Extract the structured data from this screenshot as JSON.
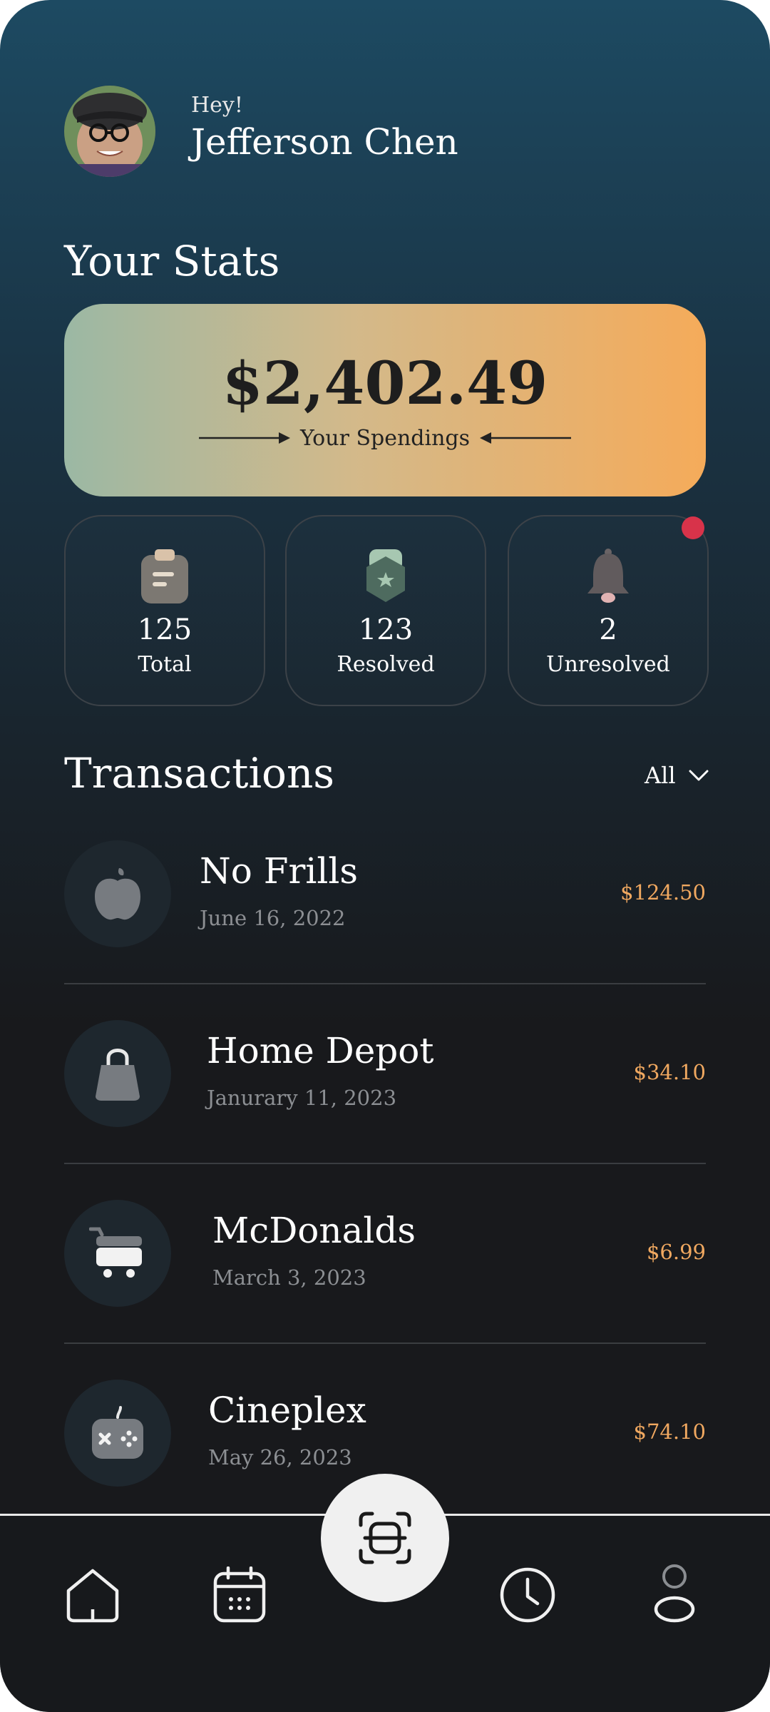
{
  "header": {
    "greeting": "Hey!",
    "name": "Jefferson Chen",
    "avatar_icon": "user-avatar-photo"
  },
  "stats": {
    "title": "Your Stats",
    "spendings": {
      "amount": "$2,402.49",
      "label": "Your Spendings"
    },
    "tiles": [
      {
        "value": "125",
        "label": "Total",
        "icon": "clipboard-icon"
      },
      {
        "value": "123",
        "label": "Resolved",
        "icon": "badge-check-icon"
      },
      {
        "value": "2",
        "label": "Unresolved",
        "icon": "bell-icon",
        "has_notification": true
      }
    ]
  },
  "transactions": {
    "title": "Transactions",
    "filter": {
      "selected": "All"
    },
    "items": [
      {
        "name": "No Frills",
        "date": "June 16, 2022",
        "amount": "$124.50",
        "icon": "apple-icon"
      },
      {
        "name": "Home Depot",
        "date": "Janurary 11, 2023",
        "amount": "$34.10",
        "icon": "shopping-bag-icon"
      },
      {
        "name": "McDonalds",
        "date": "March 3, 2023",
        "amount": "$6.99",
        "icon": "shopping-cart-icon"
      },
      {
        "name": "Cineplex",
        "date": "May 26, 2023",
        "amount": "$74.10",
        "icon": "game-controller-icon"
      }
    ]
  },
  "nav": {
    "items": [
      "home-icon",
      "calendar-icon",
      "scan-icon",
      "clock-icon",
      "profile-icon"
    ]
  },
  "colors": {
    "accent_amount": "#f0a860",
    "notification": "#d8334a",
    "card_gradient_start": "#9bb8a4",
    "card_gradient_end": "#f5ab5a"
  }
}
